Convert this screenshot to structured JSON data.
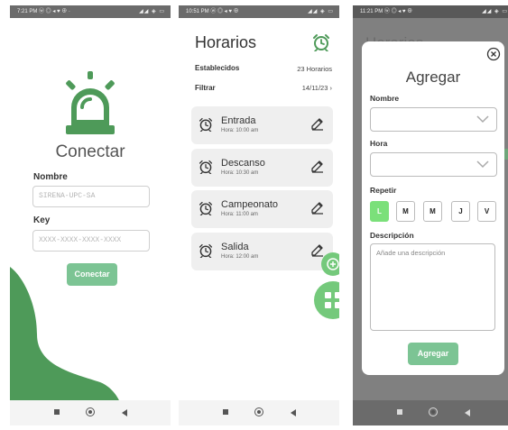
{
  "colors": {
    "accent": "#4e9a59",
    "button": "#7cc494",
    "fab": "#74c97b",
    "selected_day": "#7be07a"
  },
  "screen1": {
    "status": {
      "time": "7:21 PM ⓦ ◎ ◂ ♥ ⊕ ·",
      "right": "◢◢ ◈ ▭"
    },
    "title": "Conectar",
    "name_label": "Nombre",
    "name_placeholder": "SIRENA-UPC-SA",
    "key_label": "Key",
    "key_placeholder": "XXXX-XXXX-XXXX-XXXX",
    "button": "Conectar",
    "logo_icon": "siren-icon"
  },
  "screen2": {
    "status": {
      "time": "10:51 PM ⓦ ◎ ◂ ♥ ⊕",
      "right": "◢◢ ◈ ▭"
    },
    "title": "Horarios",
    "established_label": "Establecidos",
    "established_value": "23 Horarios",
    "filter_label": "Filtrar",
    "filter_value": "14/11/23 ›",
    "items": [
      {
        "name": "Entrada",
        "time": "Hora: 10:00 am"
      },
      {
        "name": "Descanso",
        "time": "Hora: 10:30 am"
      },
      {
        "name": "Campeonato",
        "time": "Hora: 11:00 am"
      },
      {
        "name": "Salida",
        "time": "Hora: 12:00 am"
      }
    ]
  },
  "screen3": {
    "status": {
      "time": "11:21 PM ⓦ ◎ ◂ ♥ ⊕",
      "right": "◢◢ ◈ ▭"
    },
    "background_title": "Horarios",
    "title": "Agregar",
    "name_label": "Nombre",
    "hour_label": "Hora",
    "repeat_label": "Repetir",
    "days": [
      "L",
      "M",
      "M",
      "J",
      "V"
    ],
    "selected_days": [
      "L"
    ],
    "description_label": "Descripción",
    "description_placeholder": "Añade una descripción",
    "button": "Agregar"
  }
}
